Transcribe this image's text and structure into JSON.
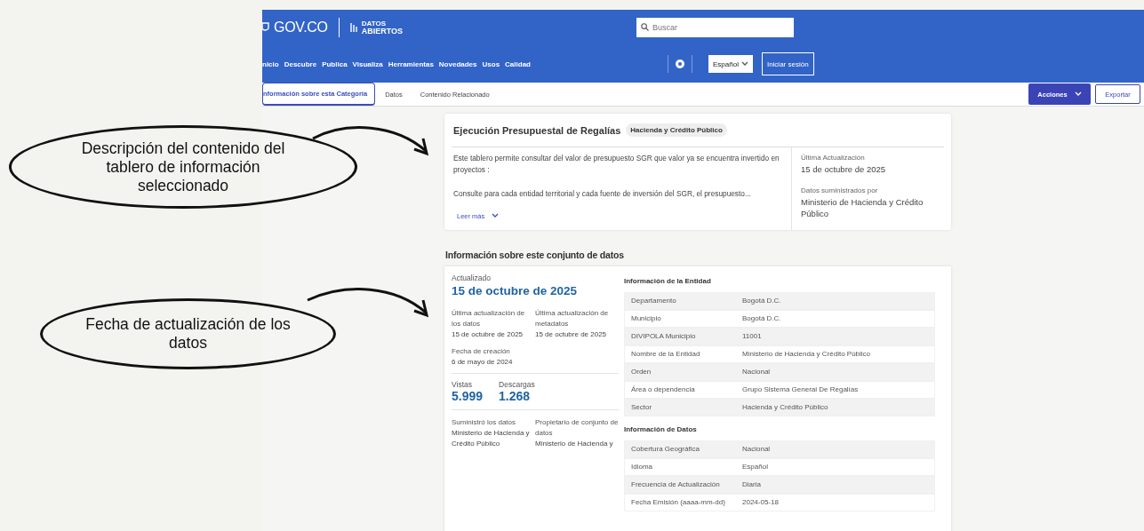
{
  "header": {
    "logo": "GOV.CO",
    "sublogo_top": "DATOS",
    "sublogo_bottom": "ABIERTOS",
    "search": {
      "placeholder": "Buscar"
    },
    "nav": [
      "nicio",
      "Descubre",
      "Publica",
      "Visualiza",
      "Herramientas",
      "Novedades",
      "Usos",
      "Calidad"
    ],
    "language": "Español",
    "login": "Iniciar sesión"
  },
  "tabs": [
    {
      "label": "nformación sobre esta Categoría",
      "selected": true
    },
    {
      "label": "Datos",
      "selected": false
    },
    {
      "label": "Contenido Relacionado",
      "selected": false
    }
  ],
  "actions": {
    "primary": "Acciones",
    "secondary": "Exportar"
  },
  "summary": {
    "title": "Ejecución Presupuestal de Regalías",
    "tag": "Hacienda y Crédito Público",
    "paragraphs": [
      "Este tablero permite consultar del valor de presupuesto SGR que valor ya se encuentra invertido en proyectos :",
      "Consulte para cada entidad territorial y cada fuente de inversión del SGR, el presupuesto..."
    ],
    "more": "Leer más",
    "updated_label": "Última Actualización",
    "updated": "15 de octubre de 2025",
    "provider_label": "Datos suministrados por",
    "provider": "Ministerio de Hacienda y Crédito Público"
  },
  "dataset": {
    "heading": "Información sobre este conjunto de datos",
    "updated_label": "Actualizado",
    "updated": "15 de octubre de 2025",
    "dates": [
      {
        "label": "Última actualización de los datos",
        "value": "15 de octubre de 2025"
      },
      {
        "label": "Última actualización de metadatos",
        "value": "15 de octubre de 2025"
      }
    ],
    "created": {
      "label": "Fecha de creación",
      "value": "6 de mayo de 2024"
    },
    "stats": [
      {
        "label": "Vistas",
        "value": "5.999"
      },
      {
        "label": "Descargas",
        "value": "1.268"
      }
    ],
    "owners": [
      {
        "label": "Suministró los datos",
        "value": "Ministerio de Hacienda y Crédito Público"
      },
      {
        "label": "Propietario de conjunto de datos",
        "value": "Ministerio de Hacienda y"
      }
    ],
    "tables": [
      {
        "title": "Información de la Entidad",
        "rows": [
          {
            "label": "Departamento",
            "value": "Bogotá D.C."
          },
          {
            "label": "Municipio",
            "value": "Bogotá D.C."
          },
          {
            "label": "DIVIPOLA Municipio",
            "value": "11001"
          },
          {
            "label": "Nombre de la Entidad",
            "value": "Ministerio de Hacienda y Crédito Público"
          },
          {
            "label": "Orden",
            "value": "Nacional"
          },
          {
            "label": "Área o dependencia",
            "value": "Grupo Sistema General De Regalías"
          },
          {
            "label": "Sector",
            "value": "Hacienda y Crédito Público"
          }
        ]
      },
      {
        "title": "Información de Datos",
        "rows": [
          {
            "label": "Cobertura Geográfica",
            "value": "Nacional"
          },
          {
            "label": "Idioma",
            "value": "Español"
          },
          {
            "label": "Frecuencia de Actualización",
            "value": "Diaria"
          },
          {
            "label": "Fecha Emisión (aaaa-mm-dd)",
            "value": "2024-05-18"
          }
        ]
      }
    ]
  },
  "callouts": [
    {
      "text": "Descripción del contenido del tablero de información seleccionado"
    },
    {
      "text": "Fecha de actualización de los datos"
    }
  ]
}
